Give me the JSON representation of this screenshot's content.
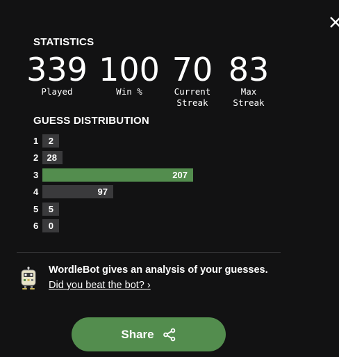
{
  "statistics": {
    "title": "STATISTICS",
    "items": [
      {
        "value": "339",
        "label": "Played"
      },
      {
        "value": "100",
        "label": "Win %"
      },
      {
        "value": "70",
        "label": "Current\nStreak"
      },
      {
        "value": "83",
        "label": "Max\nStreak"
      }
    ]
  },
  "distribution": {
    "title": "GUESS DISTRIBUTION",
    "max": 207,
    "highlight_guess": 3,
    "rows": [
      {
        "guess": "1",
        "count": 2
      },
      {
        "guess": "2",
        "count": 28
      },
      {
        "guess": "3",
        "count": 207
      },
      {
        "guess": "4",
        "count": 97
      },
      {
        "guess": "5",
        "count": 5
      },
      {
        "guess": "6",
        "count": 0
      }
    ]
  },
  "wordlebot": {
    "text": "WordleBot gives an analysis of your guesses.",
    "link": "Did you beat the bot? ›"
  },
  "share": {
    "label": "Share",
    "icon": "share-icon"
  },
  "close": {
    "icon": "close-icon"
  },
  "colors": {
    "background": "#121213",
    "bar": "#3a3a3c",
    "highlight": "#538d4e",
    "text": "#ffffff"
  }
}
